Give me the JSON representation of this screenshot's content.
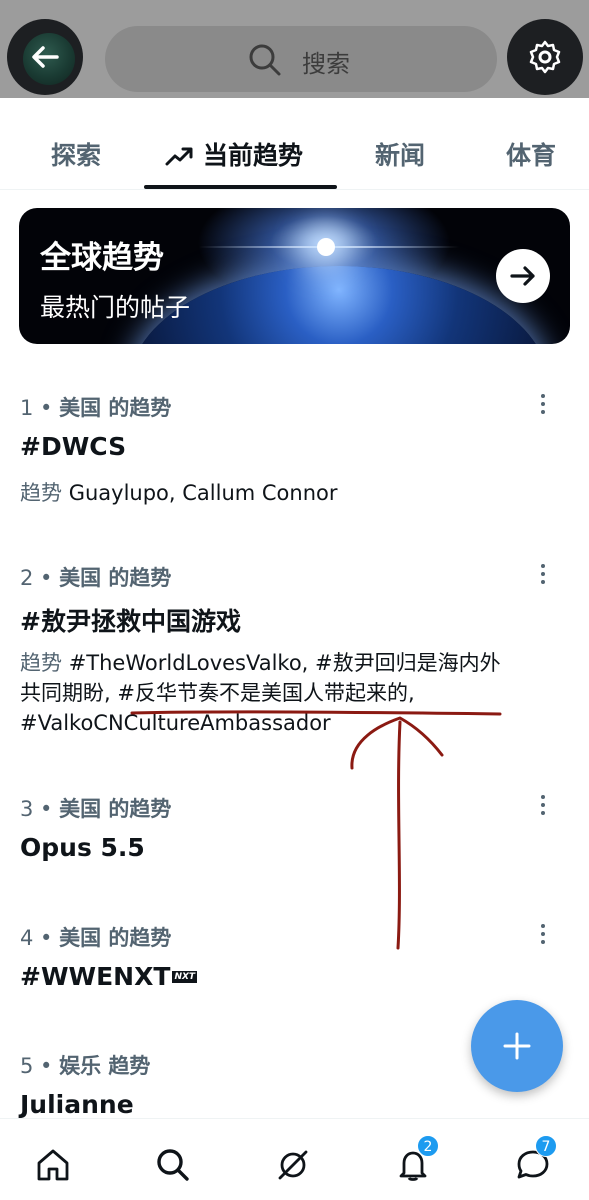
{
  "search": {
    "placeholder": "搜索"
  },
  "tabs": [
    {
      "label": "探索"
    },
    {
      "label": "当前趋势"
    },
    {
      "label": "新闻"
    },
    {
      "label": "体育"
    }
  ],
  "banner": {
    "title": "全球趋势",
    "subtitle": "最热门的帖子"
  },
  "trends": [
    {
      "rank": "1",
      "meta": "美国 的趋势",
      "title": "#DWCS",
      "lead": "趋势",
      "desc": "Guaylupo, Callum Connor"
    },
    {
      "rank": "2",
      "meta": "美国 的趋势",
      "title": "#敖尹拯救中国游戏",
      "lead": "趋势",
      "desc_line1": "#TheWorldLovesValko, #敖尹回归是海内外",
      "desc_line2": "共同期盼, #反华节奏不是美国人带起来的,",
      "desc_line3": "#ValkoCNCultureAmbassador"
    },
    {
      "rank": "3",
      "meta": "美国 的趋势",
      "title": "Opus 5.5"
    },
    {
      "rank": "4",
      "meta": "美国 的趋势",
      "title": "#WWENXT",
      "badge": "NXT"
    },
    {
      "rank": "5",
      "meta": "娱乐 趋势",
      "title": "Julianne"
    }
  ],
  "colors": {
    "accent": "#1d9bf0",
    "fab": "#4a99e9",
    "annotation": "#8b1a12"
  },
  "bottom_nav": {
    "notifications_badge": "2",
    "messages_badge": "7"
  }
}
